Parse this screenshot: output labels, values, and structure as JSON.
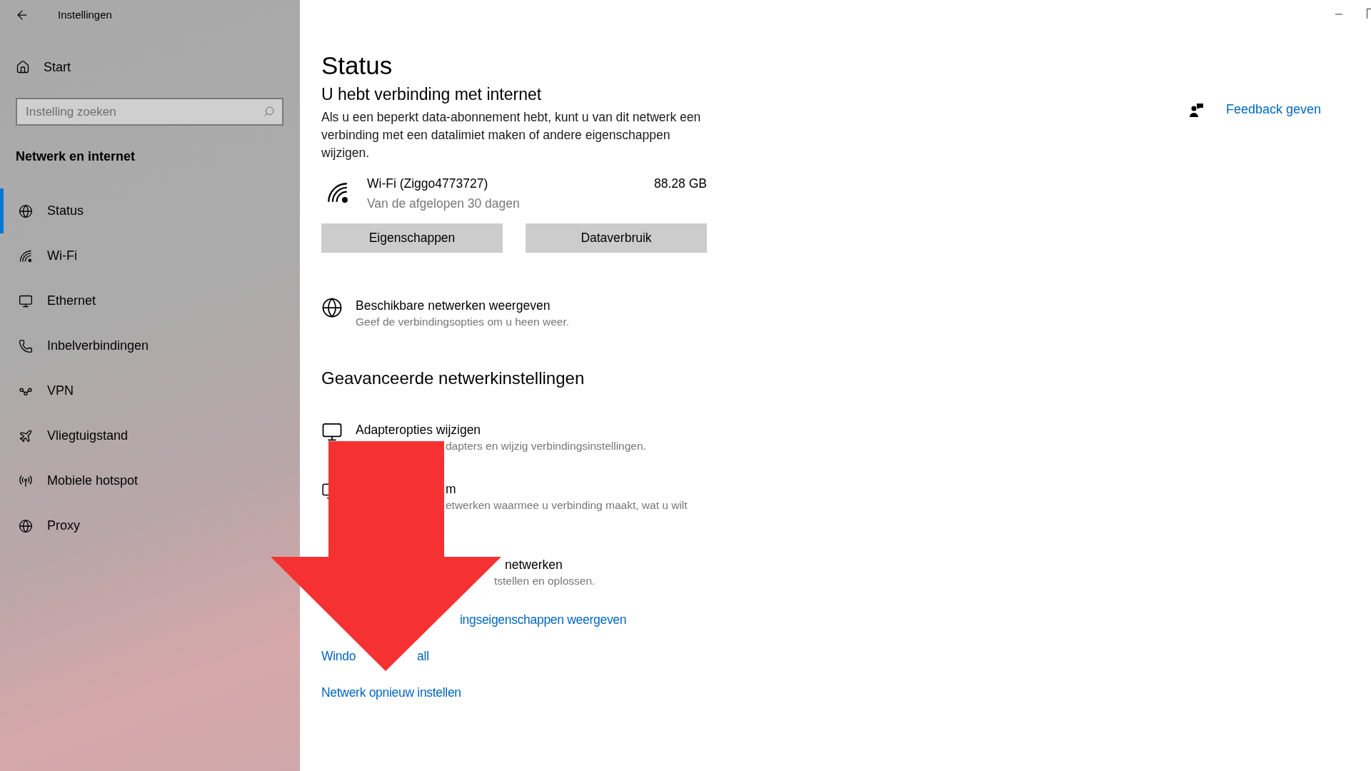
{
  "window": {
    "title": "Instellingen"
  },
  "sidebar": {
    "home": "Start",
    "search": {
      "placeholder": "Instelling zoeken"
    },
    "section": "Netwerk en internet",
    "items": [
      {
        "label": "Status",
        "kind": "status",
        "selected": true
      },
      {
        "label": "Wi-Fi",
        "kind": "wifi",
        "selected": false
      },
      {
        "label": "Ethernet",
        "kind": "ethernet",
        "selected": false
      },
      {
        "label": "Inbelverbindingen",
        "kind": "dialup",
        "selected": false
      },
      {
        "label": "VPN",
        "kind": "vpn",
        "selected": false
      },
      {
        "label": "Vliegtuigstand",
        "kind": "airplane",
        "selected": false
      },
      {
        "label": "Mobiele hotspot",
        "kind": "hotspot",
        "selected": false
      },
      {
        "label": "Proxy",
        "kind": "proxy",
        "selected": false
      }
    ]
  },
  "main": {
    "title": "Status",
    "subtitle": "U hebt verbinding met internet",
    "description": "Als u een beperkt data-abonnement hebt, kunt u van dit netwerk een verbinding met een datalimiet maken of andere eigenschappen wijzigen.",
    "network": {
      "name": "Wi-Fi (Ziggo4773727)",
      "usage": "88.28 GB",
      "period": "Van de afgelopen 30 dagen"
    },
    "buttons": [
      "Eigenschappen",
      "Dataverbruik"
    ],
    "show_networks": {
      "title": "Beschikbare netwerken weergeven",
      "subtitle": "Geef de verbindingsopties om u heen weer."
    },
    "advanced_heading": "Geavanceerde netwerkinstellingen",
    "advanced_items": [
      {
        "title": "Adapteropties wijzigen",
        "subtitle": "dapters en wijzig verbindingsinstellingen."
      },
      {
        "title": "m",
        "subtitle": "etwerken waarmee u verbinding maakt, wat u wilt"
      },
      {
        "title": "netwerken",
        "subtitle": "tstellen en oplossen."
      }
    ],
    "links": [
      {
        "parts": [
          "ingseigenschappen weergeven"
        ]
      },
      {
        "parts": [
          "Windo",
          "all"
        ]
      },
      {
        "parts": [
          "Netwerk opnieuw instellen"
        ]
      }
    ]
  },
  "feedback": "Feedback geven"
}
